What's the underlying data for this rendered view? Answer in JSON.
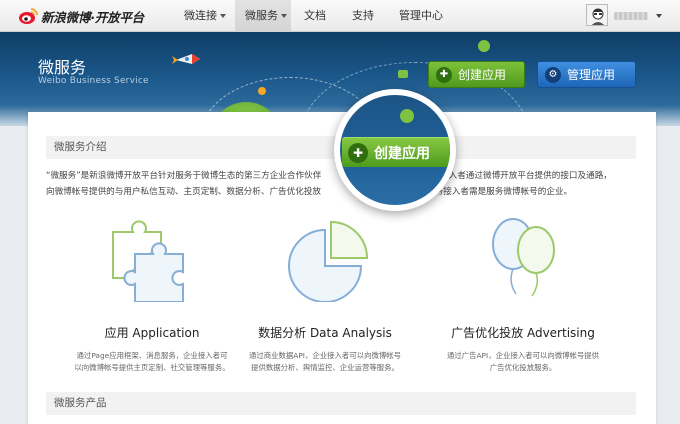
{
  "brand": {
    "logo_text": "新浪微博·开放平台"
  },
  "nav": {
    "items": [
      {
        "label": "微连接",
        "dropdown": true
      },
      {
        "label": "微服务",
        "dropdown": true,
        "active": true
      },
      {
        "label": "文档"
      },
      {
        "label": "支持"
      },
      {
        "label": "管理中心"
      }
    ]
  },
  "banner": {
    "title": "微服务",
    "subtitle": "Weibo Business Service",
    "create_btn": "创建应用",
    "manage_btn": "管理应用"
  },
  "intro": {
    "heading": "微服务介绍",
    "text_line1": "“微服务”是新浪微博开放平台针对服务于微博生态的第三方企业合作伙伴",
    "text_line1b": "接入者通过微博开放平台提供的接口及通路，",
    "text_line2": "向微博帐号提供的与用户私信互动、主页定制、数据分析、广告优化投放",
    "text_line2b": "服务接入者需是服务微博帐号的企业。"
  },
  "features": [
    {
      "title": "应用 Application",
      "desc_line1": "通过Page应用框架、消息服务，企业接入者可",
      "desc_line2": "以向微博帐号提供主页定制、社交管理等服务。"
    },
    {
      "title": "数据分析 Data Analysis",
      "desc_line1": "通过商业数据API，企业接入者可以向微博帐号",
      "desc_line2": "提供数据分析、舆情监控、企业运营等服务。"
    },
    {
      "title": "广告优化投放 Advertising",
      "desc_line1": "通过广告API，企业接入者可以向微博帐号提供",
      "desc_line2": "广告优化投放服务。"
    }
  ],
  "products": {
    "heading": "微服务产品"
  },
  "magnifier": {
    "label": "创建应用"
  },
  "colors": {
    "accent_green": "#5aa925",
    "accent_blue": "#2a77cc",
    "banner_blue": "#1a5689"
  }
}
